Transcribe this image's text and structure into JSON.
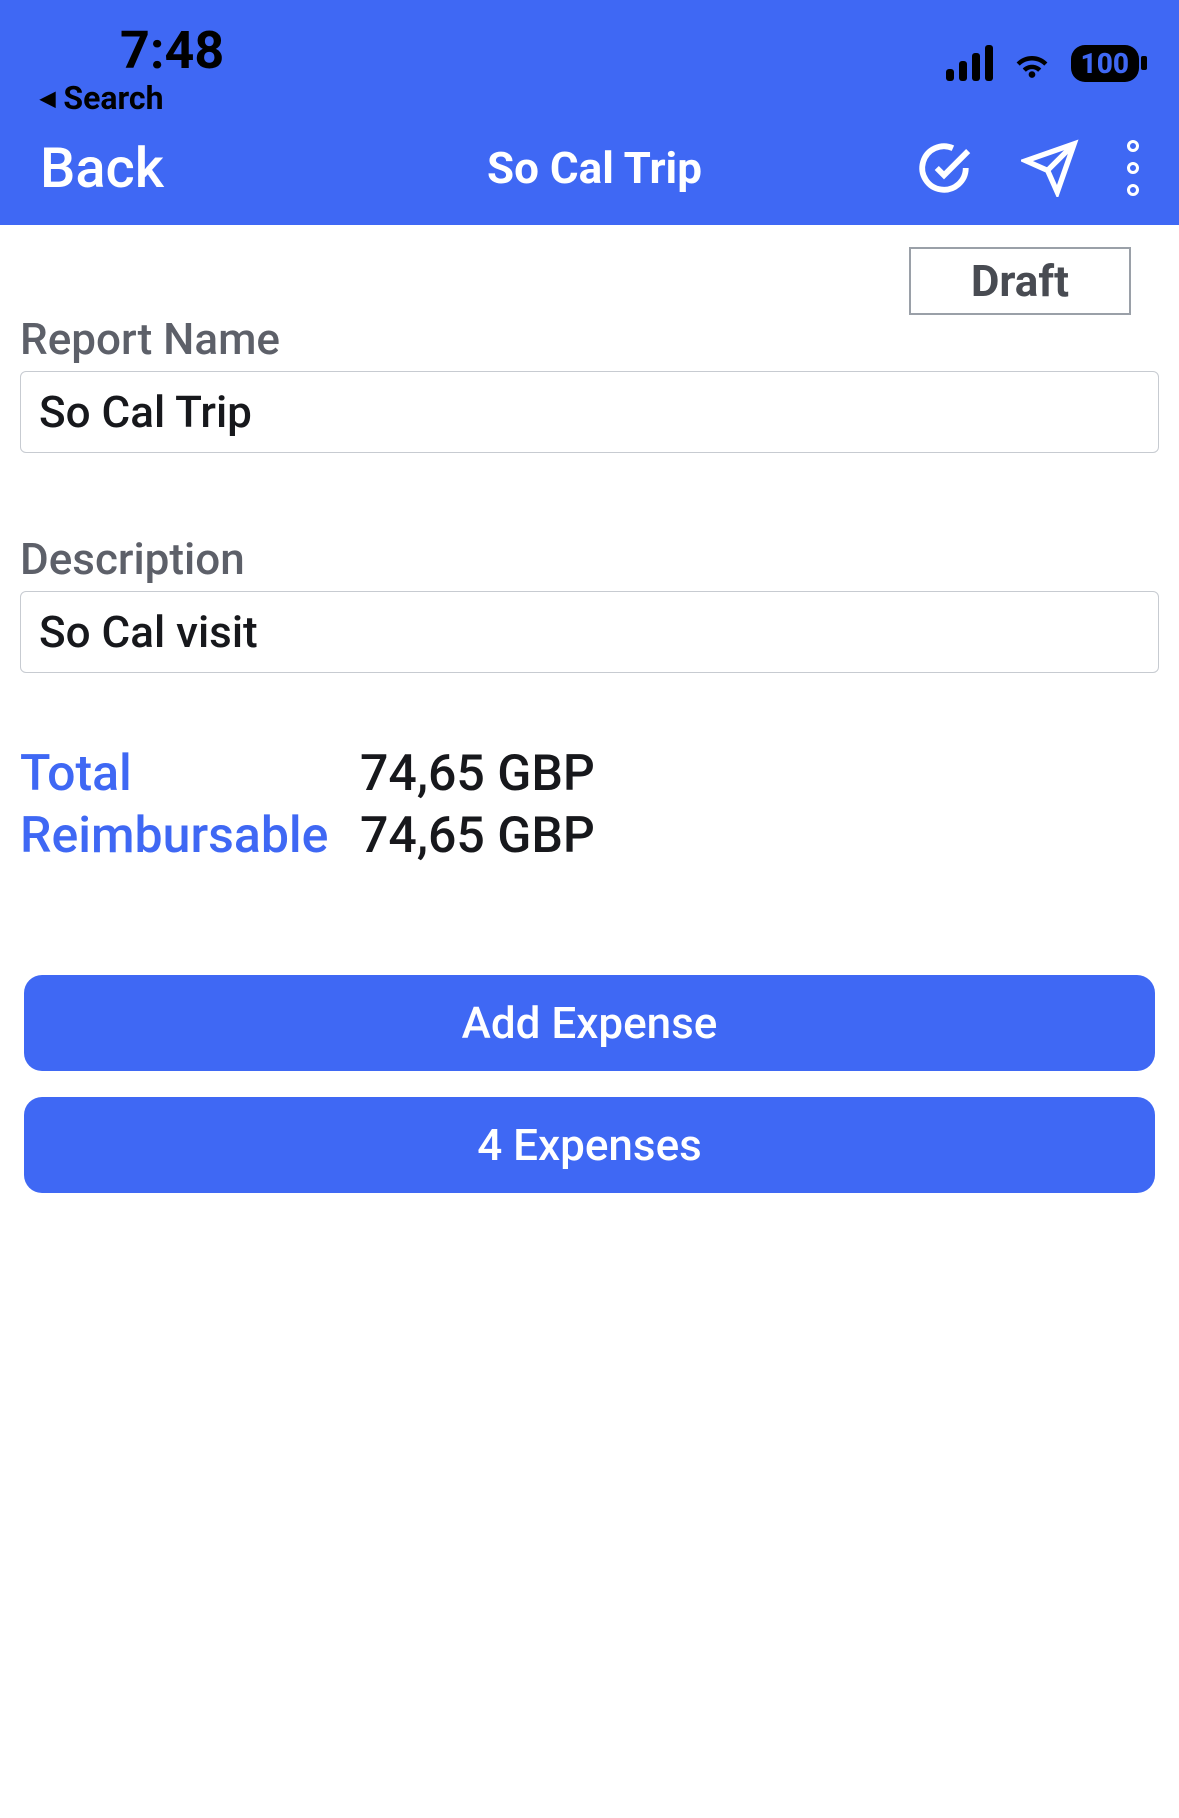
{
  "status_bar": {
    "time": "7:48",
    "back_link": "Search",
    "battery": "100"
  },
  "nav": {
    "back_label": "Back",
    "title": "So Cal Trip"
  },
  "status_badge": "Draft",
  "fields": {
    "report_name_label": "Report Name",
    "report_name_value": "So Cal Trip",
    "description_label": "Description",
    "description_value": "So Cal visit"
  },
  "summary": {
    "total_label": "Total",
    "total_value": "74,65 GBP",
    "reimbursable_label": "Reimbursable",
    "reimbursable_value": "74,65 GBP"
  },
  "buttons": {
    "add_expense": "Add Expense",
    "expenses_list": "4 Expenses"
  }
}
